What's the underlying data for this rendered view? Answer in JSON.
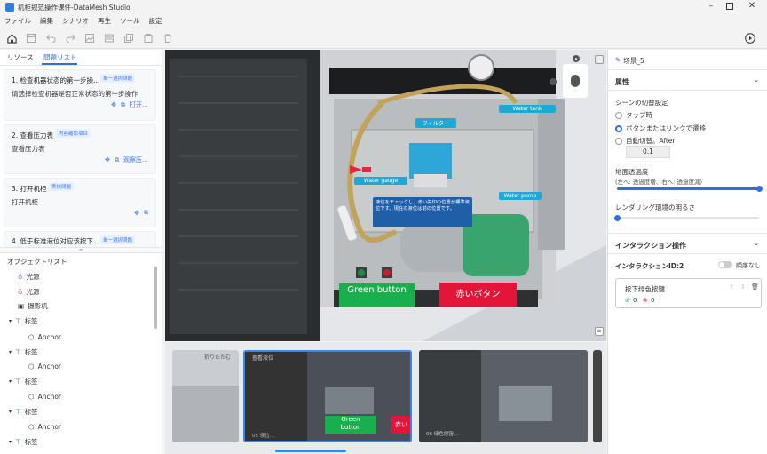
{
  "window": {
    "title": "机柜规范操作课件-DataMesh Studio",
    "minimize_icon": "minimize-icon",
    "maximize_icon": "maximize-icon",
    "close_icon": "close-icon"
  },
  "menu": [
    "ファイル",
    "編集",
    "シナリオ",
    "再生",
    "ツール",
    "設定"
  ],
  "toolbar": {
    "icons": [
      "home-icon",
      "save-icon",
      "undo-icon",
      "redo-icon",
      "image-icon",
      "layers-icon",
      "copy-icon",
      "paste-icon",
      "delete-icon"
    ],
    "play_icon": "play-icon"
  },
  "left_panel": {
    "tabs": [
      "リソース",
      "問題リスト"
    ],
    "active_tab": "問題リスト",
    "questions": [
      {
        "title": "1. 检查机器状态的第一步操…",
        "badge": "単一選択問題",
        "desc": "请选择检查机器是否正常状态的第一步操作",
        "action": "打开…"
      },
      {
        "title": "2. 查看压力表",
        "badge": "内容確認項目",
        "desc": "查看压力表",
        "action": "观察压…"
      },
      {
        "title": "3. 打开机柜",
        "badge": "実技問題",
        "desc": "打开机柜",
        "action": ""
      },
      {
        "title": "4. 低于标准液位对应该按下…",
        "badge": "単一選択問題",
        "desc": "",
        "action": ""
      }
    ],
    "object_list_title": "オブジェクトリスト",
    "objects": [
      {
        "label": "光源",
        "icon": "bulb-icon",
        "indent": 1
      },
      {
        "label": "光源",
        "icon": "bulb-icon",
        "indent": 1
      },
      {
        "label": "摄影机",
        "icon": "camera-icon",
        "indent": 1
      },
      {
        "label": "标签",
        "icon": "label-icon",
        "indent": 0
      },
      {
        "label": "Anchor",
        "icon": "cube-icon",
        "indent": 2
      },
      {
        "label": "标签",
        "icon": "label-icon",
        "indent": 0
      },
      {
        "label": "Anchor",
        "icon": "cube-icon",
        "indent": 2
      },
      {
        "label": "标签",
        "icon": "label-icon",
        "indent": 0
      },
      {
        "label": "Anchor",
        "icon": "cube-icon",
        "indent": 2
      },
      {
        "label": "标签",
        "icon": "label-icon",
        "indent": 0
      },
      {
        "label": "Anchor",
        "icon": "cube-icon",
        "indent": 2
      },
      {
        "label": "标签",
        "icon": "label-icon",
        "indent": 0
      }
    ]
  },
  "scene": {
    "labels": {
      "filter": "フィルター",
      "water_tank": "Water tank",
      "water_gauge": "Water gauge",
      "water_pump": "Water pump",
      "note": "液位をチェックし、赤い矢印の位置が標準液位です。現在の液位は前の位置です。",
      "green_button": "Green button",
      "red_button": "赤いボタン"
    }
  },
  "filmstrip": [
    {
      "caption": "折りたたむ",
      "footer": ""
    },
    {
      "caption": "查看液位",
      "footer": "05 液位..."
    },
    {
      "caption": "",
      "footer": "06 绿色按钮..."
    }
  ],
  "right_panel": {
    "scene_name": "场景_5",
    "attributes": "属性",
    "scene_switch": "シーンの切替設定",
    "options": [
      "タップ時",
      "ボタンまたはリンクで遷移",
      "自動切替。After"
    ],
    "selected_option": 1,
    "auto_value": "0.1",
    "ground_transparency": "地面透過度",
    "ground_hint": "(左へ: 透過度増、右へ: 透過度減)",
    "ground_level": 1.0,
    "rendering_brightness": "レンダリング環境の明るさ",
    "brightness_level": 0.0,
    "interaction_title": "インタラクション操作",
    "interaction_id": "インタラクションID:2",
    "order_toggle": "順序なし",
    "interaction_item": "按下绿色按键",
    "correct_count": "0",
    "wrong_count": "0"
  }
}
